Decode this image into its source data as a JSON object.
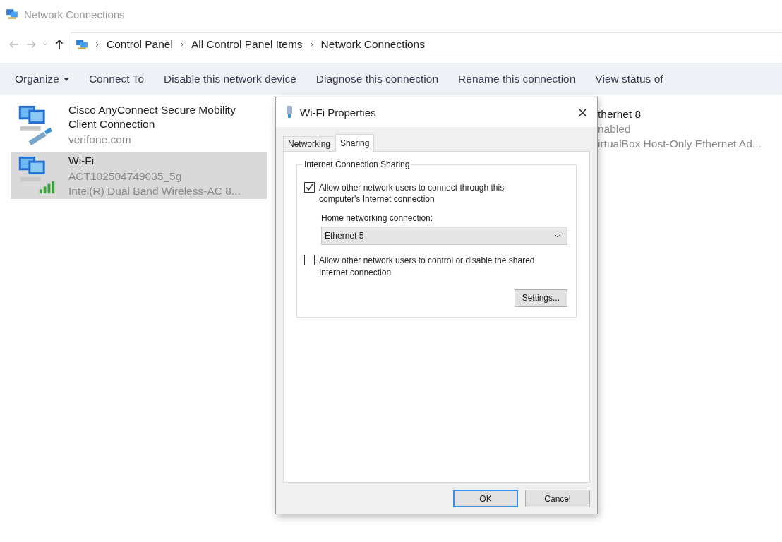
{
  "window": {
    "title": "Network Connections"
  },
  "address_bar": {
    "path": [
      "Control Panel",
      "All Control Panel Items",
      "Network Connections"
    ]
  },
  "toolbar": [
    {
      "label": "Organize",
      "kind": "menu"
    },
    {
      "label": "Connect To",
      "kind": "button"
    },
    {
      "label": "Disable this network device",
      "kind": "button"
    },
    {
      "label": "Diagnose this connection",
      "kind": "button"
    },
    {
      "label": "Rename this connection",
      "kind": "button"
    },
    {
      "label": "View status of",
      "kind": "button"
    }
  ],
  "connections": [
    {
      "name": "Cisco AnyConnect Secure Mobility Client Connection",
      "status": "verifone.com",
      "kind": "vpn",
      "selected": false
    },
    {
      "name": "Wi-Fi",
      "status": "ACT102504749035_5g",
      "device": "Intel(R) Dual Band Wireless-AC 8...",
      "kind": "wifi",
      "selected": true
    },
    {
      "name": "thernet 8",
      "status": "nabled",
      "device": "irtualBox Host-Only Ethernet Ad...",
      "selected": false
    }
  ],
  "dialog": {
    "title": "Wi-Fi Properties",
    "tabs": [
      {
        "label": "Networking",
        "selected": false
      },
      {
        "label": "Sharing",
        "selected": true
      }
    ],
    "group": {
      "title": "Internet Connection Sharing",
      "allow_connect": {
        "label": "Allow other network users to connect through this computer's Internet connection",
        "checked": true
      },
      "home_connection": {
        "label": "Home networking connection:",
        "value": "Ethernet 5"
      },
      "allow_control": {
        "label": "Allow other network users to control or disable the shared Internet connection",
        "checked": false
      },
      "settings_button": "Settings..."
    },
    "buttons": [
      {
        "label": "OK",
        "default": true
      },
      {
        "label": "Cancel",
        "default": false
      }
    ]
  }
}
